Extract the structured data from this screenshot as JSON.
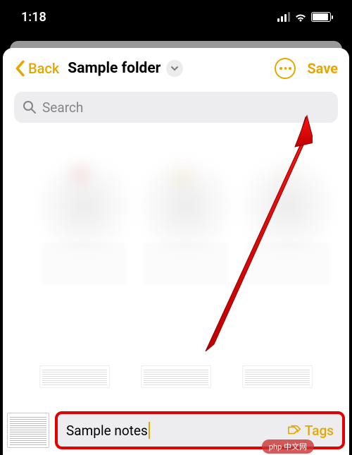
{
  "status": {
    "time": "1:18"
  },
  "nav": {
    "back_label": "Back",
    "folder_name": "Sample folder",
    "save_label": "Save"
  },
  "search": {
    "placeholder": "Search"
  },
  "notes_input": {
    "value": "Sample notes",
    "tags_label": "Tags"
  },
  "watermark": "php 中文网"
}
